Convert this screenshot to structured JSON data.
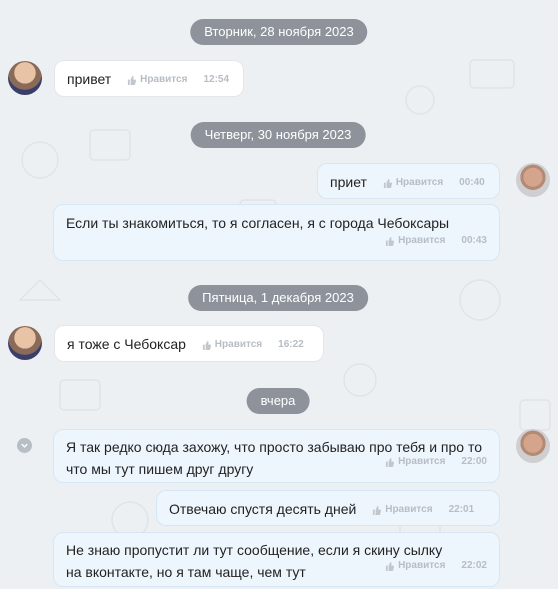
{
  "dates": [
    "Вторник, 28 ноября 2023",
    "Четверг, 30 ноября 2023",
    "Пятница, 1 декабря 2023",
    "вчера"
  ],
  "like_label": "Нравится",
  "messages": [
    {
      "text": "привет",
      "time": "12:54"
    },
    {
      "text": "приет",
      "time": "00:40"
    },
    {
      "text": "Если ты знакомиться, то я согласен, я с города Чебоксары",
      "time": "00:43"
    },
    {
      "text": "я тоже с Чебоксар",
      "time": "16:22"
    },
    {
      "text": "Я так редко сюда захожу, что просто забываю про тебя и про то что мы тут пишем друг другу",
      "time": "22:00"
    },
    {
      "text": "Отвечаю спустя десять дней",
      "time": "22:01"
    },
    {
      "text": "Не знаю пропустит ли тут сообщение, если я скину сылку на вконтакте, но я там чаще, чем тут",
      "time": "22:02"
    }
  ],
  "icons": {
    "like": "thumbs-up-icon",
    "scroll": "chevron-down-icon"
  },
  "colors": {
    "background": "#edf0f3",
    "pill": "#8e939b",
    "incoming": "#ffffff",
    "outgoing": "#eef6fd"
  }
}
